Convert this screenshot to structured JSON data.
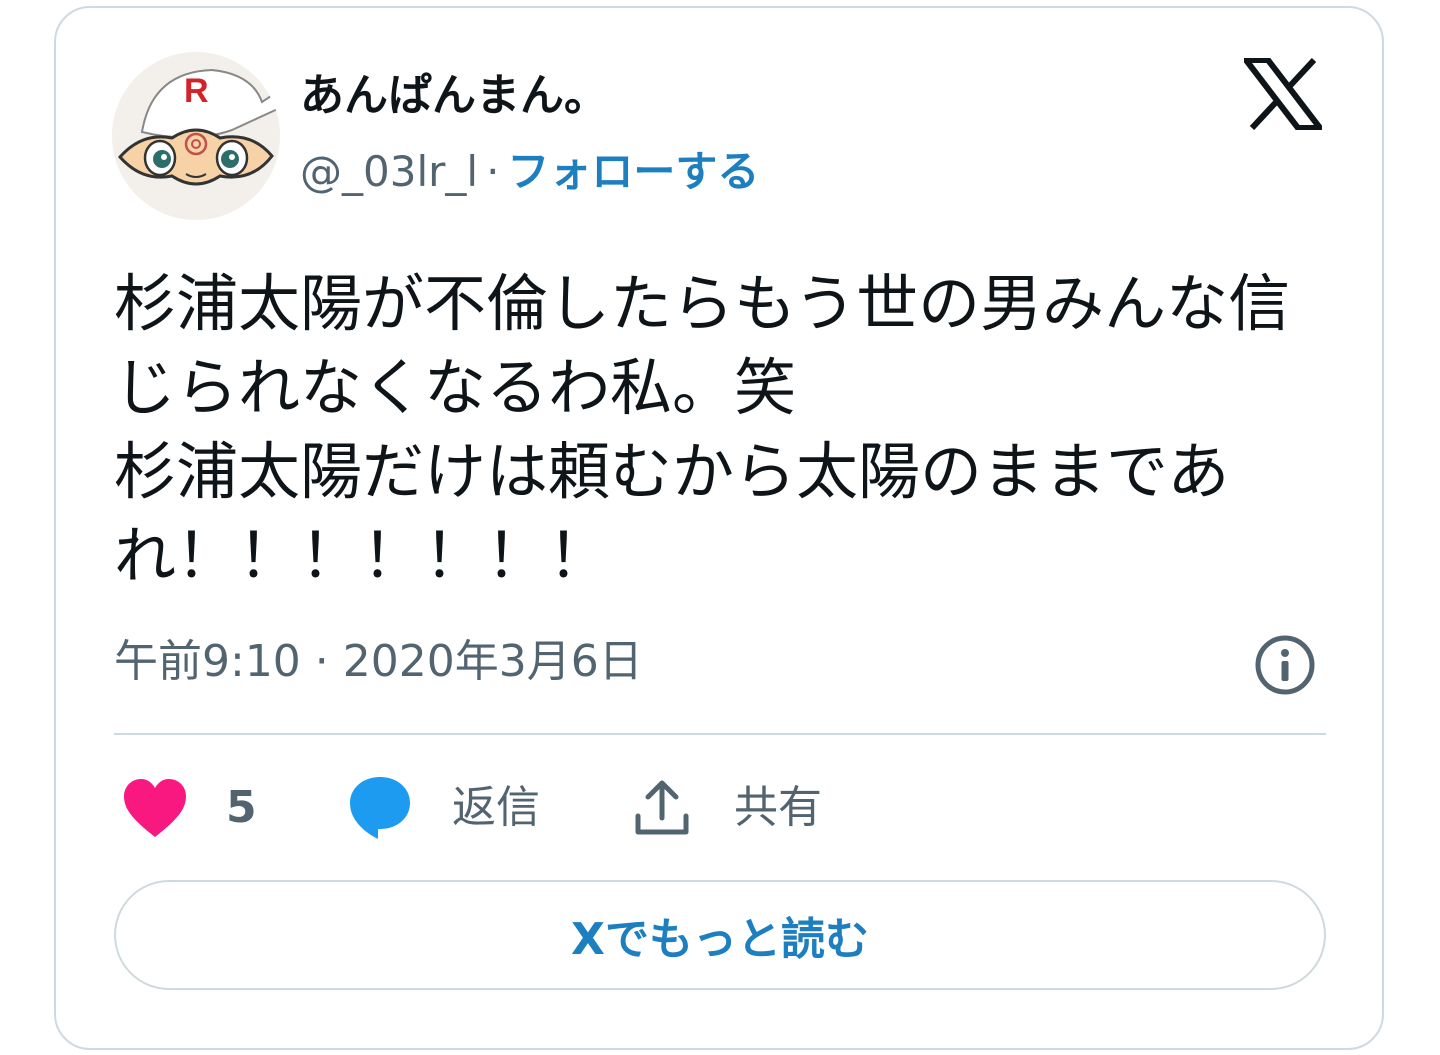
{
  "user": {
    "display_name": "あんぱんまん。",
    "handle": "@_03lr_l",
    "separator": "·",
    "follow_label": "フォローする",
    "avatar_badge": "R"
  },
  "tweet": {
    "text": "杉浦太陽が不倫したらもう世の男みんな信じられなくなるわ私。笑\n杉浦太陽だけは頼むから太陽のままであれ！！！！！！！",
    "timestamp": "午前9:10 · 2020年3月6日"
  },
  "actions": {
    "like_count": "5",
    "reply_label": "返信",
    "share_label": "共有"
  },
  "read_more_label": "Xでもっと読む",
  "icons": {
    "brand": "x-logo-icon",
    "info": "info-icon",
    "like": "heart-icon",
    "reply": "speech-bubble-icon",
    "share": "upload-icon"
  },
  "colors": {
    "text": "#0f1419",
    "secondary": "#536471",
    "link": "#1d7ec0",
    "like": "#f91880",
    "reply": "#1d9bf0",
    "border": "#cfd9de"
  }
}
